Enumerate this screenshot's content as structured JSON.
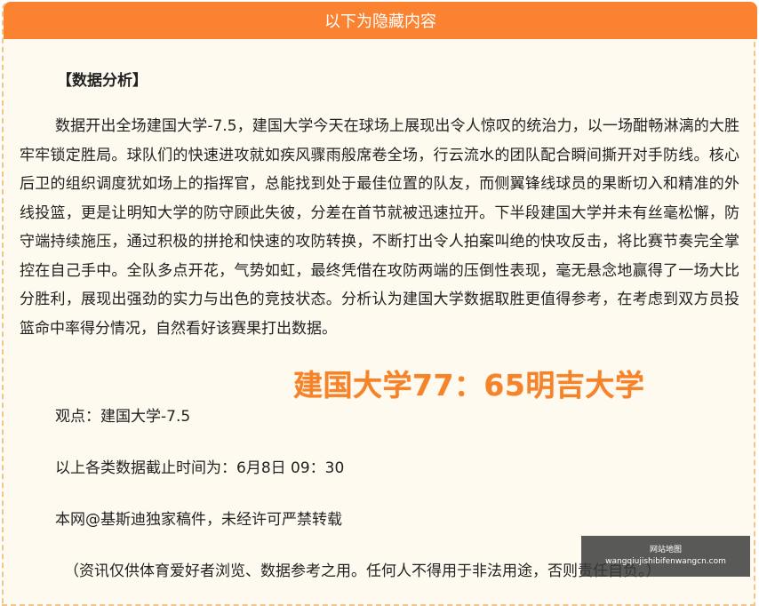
{
  "header": {
    "title": "以下为隐藏内容"
  },
  "article": {
    "section_title": "【数据分析】",
    "paragraph": "数据开出全场建国大学-7.5，建国大学今天在球场上展现出令人惊叹的统治力，以一场酣畅淋漓的大胜牢牢锁定胜局。球队们的快速进攻就如疾风骤雨般席卷全场，行云流水的团队配合瞬间撕开对手防线。核心后卫的组织调度犹如场上的指挥官，总能找到处于最佳位置的队友，而侧翼锋线球员的果断切入和精准的外线投篮，更是让明知大学的防守顾此失彼，分差在首节就被迅速拉开。下半段建国大学并未有丝毫松懈，防守端持续施压，通过积极的拼抢和快速的攻防转换，不断打出令人拍案叫绝的快攻反击，将比赛节奏完全掌控在自己手中。全队多点开花，气势如虹，最终凭借在攻防两端的压倒性表现，毫无悬念地赢得了一场大比分胜利，展现出强劲的实力与出色的竞技状态。分析认为建国大学数据取胜更值得参考，在考虑到双方员投篮命中率得分情况，自然看好该赛果打出数据。",
    "score_overlay": "建国大学77：65明吉大学",
    "viewpoint": "观点：建国大学-7.5",
    "cutoff": "以上各类数据截止时间为：6月8日 09：30",
    "copyright": "本网@基斯迪独家稿件，未经许可严禁转载",
    "disclaimer": "（资讯仅供体育爱好者浏览、数据参考之用。任何人不得用于非法用途，否则责任自负。）"
  },
  "watermark": {
    "line1": "网站地图",
    "line2": "wangqiujishibifenwangcn.com"
  },
  "colors": {
    "header_bg": "#fa8230",
    "score": "#f5832a",
    "panel_bg": "#fffaf0"
  }
}
